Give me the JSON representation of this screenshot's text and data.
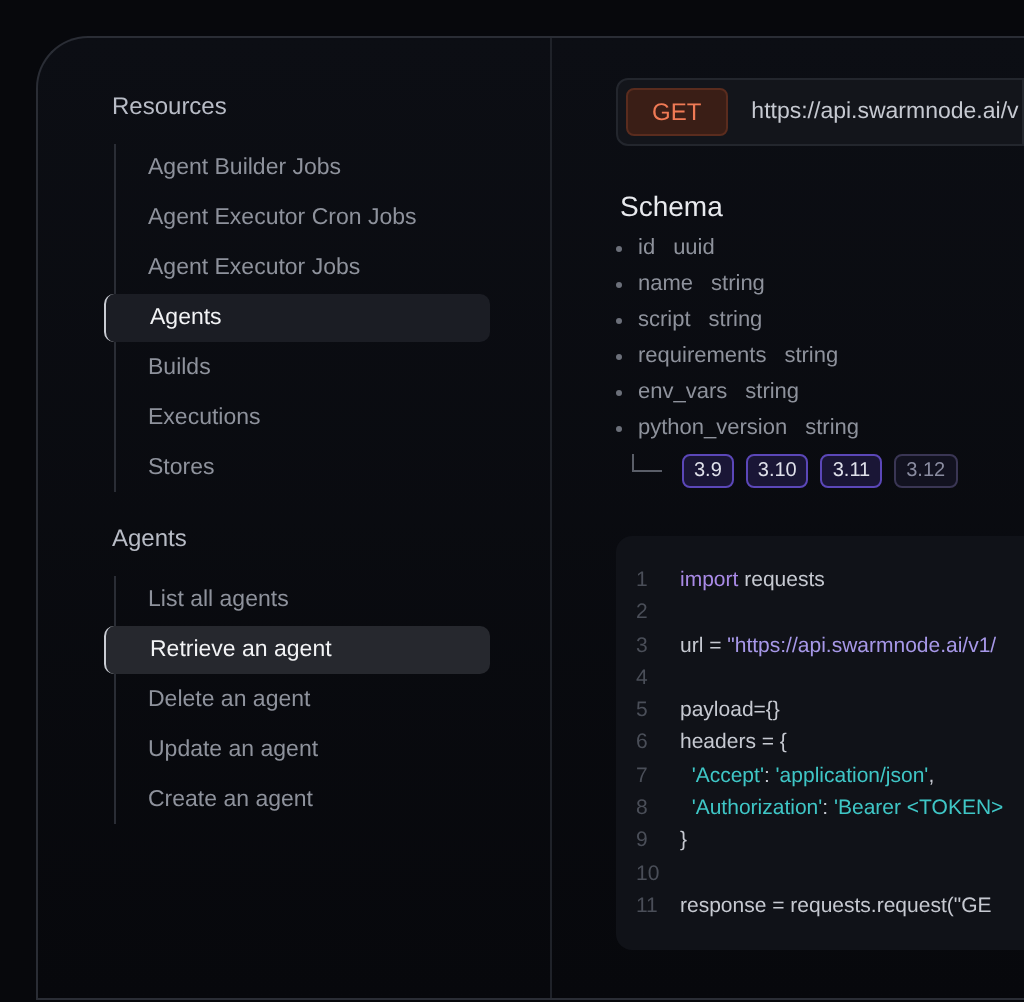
{
  "sidebar": {
    "sections": [
      {
        "title": "Resources",
        "items": [
          {
            "label": "Agent Builder Jobs",
            "selected": false
          },
          {
            "label": "Agent Executor Cron Jobs",
            "selected": false
          },
          {
            "label": "Agent Executor Jobs",
            "selected": false
          },
          {
            "label": "Agents",
            "selected": true
          },
          {
            "label": "Builds",
            "selected": false
          },
          {
            "label": "Executions",
            "selected": false
          },
          {
            "label": "Stores",
            "selected": false
          }
        ]
      },
      {
        "title": "Agents",
        "items": [
          {
            "label": "List all agents",
            "selected": false
          },
          {
            "label": "Retrieve an agent",
            "selected": true
          },
          {
            "label": "Delete an agent",
            "selected": false
          },
          {
            "label": "Update an agent",
            "selected": false
          },
          {
            "label": "Create an agent",
            "selected": false
          }
        ]
      }
    ]
  },
  "endpoint": {
    "method": "GET",
    "url": "https://api.swarmnode.ai/v"
  },
  "schema": {
    "title": "Schema",
    "fields": [
      {
        "name": "id",
        "type": "uuid"
      },
      {
        "name": "name",
        "type": "string"
      },
      {
        "name": "script",
        "type": "string"
      },
      {
        "name": "requirements",
        "type": "string"
      },
      {
        "name": "env_vars",
        "type": "string"
      },
      {
        "name": "python_version",
        "type": "string",
        "options": [
          {
            "label": "3.9",
            "disabled": false
          },
          {
            "label": "3.10",
            "disabled": false
          },
          {
            "label": "3.11",
            "disabled": false
          },
          {
            "label": "3.12",
            "disabled": true
          }
        ]
      }
    ]
  },
  "code": {
    "lines": [
      {
        "number": "1",
        "tokens": [
          {
            "kind": "keyword",
            "text": "import"
          },
          {
            "kind": "plain",
            "text": " requests"
          }
        ]
      },
      {
        "number": "2"
      },
      {
        "number": "3",
        "tokens": [
          {
            "kind": "plain",
            "text": "url = "
          },
          {
            "kind": "string",
            "text": "\"https://api.swarmnode.ai/v1/"
          }
        ]
      },
      {
        "number": "4"
      },
      {
        "number": "5",
        "tokens": [
          {
            "kind": "plain",
            "text": "payload={}"
          }
        ]
      },
      {
        "number": "6",
        "tokens": [
          {
            "kind": "plain",
            "text": "headers = {"
          }
        ]
      },
      {
        "number": "7",
        "tokens": [
          {
            "kind": "key",
            "text": "  'Accept'"
          },
          {
            "kind": "plain",
            "text": ": "
          },
          {
            "kind": "key",
            "text": "'application/json'"
          },
          {
            "kind": "plain",
            "text": ","
          }
        ]
      },
      {
        "number": "8",
        "tokens": [
          {
            "kind": "key",
            "text": "  'Authorization'"
          },
          {
            "kind": "plain",
            "text": ": "
          },
          {
            "kind": "key",
            "text": "'Bearer <TOKEN>"
          }
        ]
      },
      {
        "number": "9",
        "tokens": [
          {
            "kind": "plain",
            "text": "}"
          }
        ]
      },
      {
        "number": "10"
      },
      {
        "number": "11",
        "tokens": [
          {
            "kind": "plain",
            "text": "response = requests.request(\"GE"
          }
        ]
      }
    ]
  }
}
